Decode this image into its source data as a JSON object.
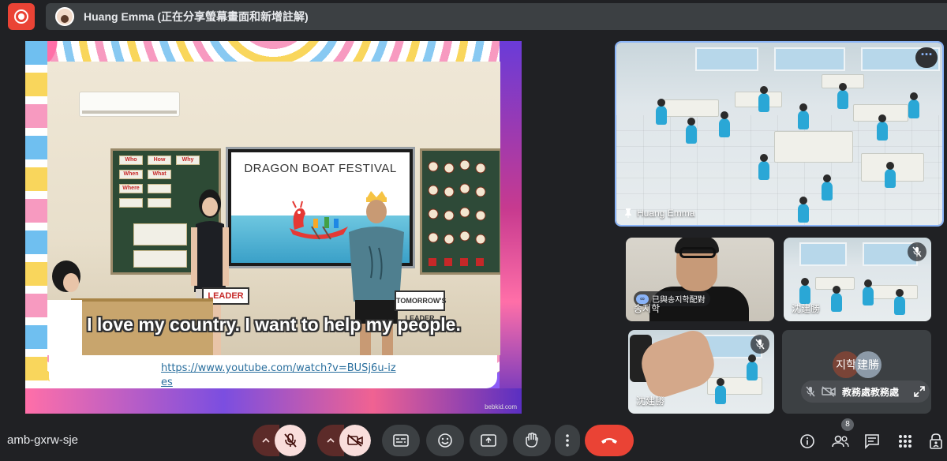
{
  "top_bar": {
    "presenter_label": "Huang Emma (正在分享螢幕畫面和新增註解)"
  },
  "presentation": {
    "tv_title": "DRAGON BOAT FESTIVAL",
    "subtitle": "I love my country. I want to help my people.",
    "link_text": "https://www.youtube.com/watch?v=BUSj6u-izes",
    "sign_text": "TOMORROW'S LEADER",
    "sign_text_2": "LEADER",
    "board_cards": [
      "Who",
      "How",
      "Why",
      "When",
      "What",
      "Where"
    ],
    "watermark": "bebkid.com"
  },
  "tiles": {
    "pinned": {
      "name": "Huang Emma"
    },
    "tile_a": {
      "name": "송지학",
      "paired_label": "已與송지학配對"
    },
    "tile_b": {
      "name": "沈建勝"
    },
    "tile_c": {
      "name": "沈建勝"
    },
    "tile_d": {
      "group_label": "教務處教務處",
      "avatar_1": "지학",
      "avatar_2": "建勝"
    }
  },
  "toolbar": {
    "meeting_code": "amb-gxrw-sje",
    "participant_count": "8"
  },
  "colors": {
    "background": "#202124",
    "tile": "#3c4043",
    "end_call": "#ea4335",
    "pin_border": "#8ab4f8",
    "muted_pill": "#f9dedc"
  }
}
